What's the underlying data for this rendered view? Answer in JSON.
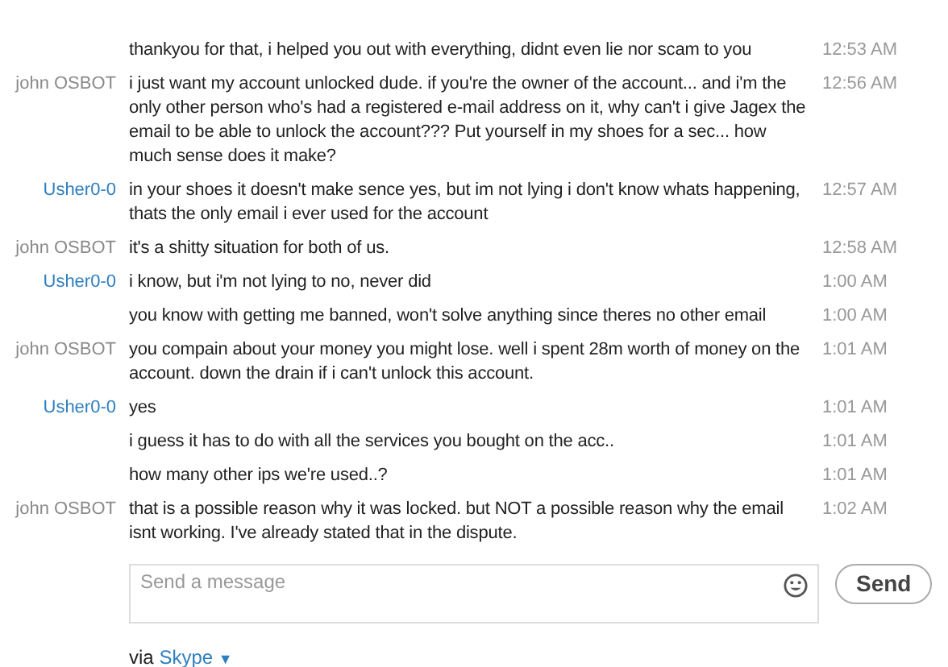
{
  "messages": [
    {
      "kind": "outgoing",
      "text": "thankyou for that, i helped you out with everything, didnt even lie nor scam to you",
      "time": "12:53 AM"
    },
    {
      "kind": "incoming",
      "sender": "john OSBOT",
      "text": "i just want my account unlocked dude. if you're the owner of the account... and i'm the only other person who's had a registered e-mail address on it, why can't i give Jagex the email to be able to unlock the account??? Put yourself in my shoes for a sec... how much sense does it make?",
      "time": "12:56 AM"
    },
    {
      "kind": "outgoing",
      "sender": "Usher0-0",
      "text": "in your shoes it doesn't make sence yes, but im not lying i don't know whats happening, thats the only email i ever used for the account",
      "time": "12:57 AM"
    },
    {
      "kind": "incoming",
      "sender": "john OSBOT",
      "text": "it's a shitty situation for both of us.",
      "time": "12:58 AM"
    },
    {
      "kind": "outgoing",
      "sender": "Usher0-0",
      "text": "i know, but i'm not lying to no, never did",
      "time": "1:00 AM"
    },
    {
      "kind": "outgoing",
      "text": "you know with getting me banned, won't solve anything since theres no other email",
      "time": "1:00 AM"
    },
    {
      "kind": "incoming",
      "sender": "john OSBOT",
      "text": "you compain about your money you might lose. well i spent 28m worth of money on the account. down the drain if i can't unlock this account.",
      "time": "1:01 AM"
    },
    {
      "kind": "outgoing",
      "sender": "Usher0-0",
      "text": "yes",
      "time": "1:01 AM"
    },
    {
      "kind": "outgoing",
      "text": "i guess it has to do with all the services you bought on the acc..",
      "time": "1:01 AM"
    },
    {
      "kind": "outgoing",
      "text": "how many other ips we're used..?",
      "time": "1:01 AM"
    },
    {
      "kind": "incoming",
      "sender": "john OSBOT",
      "text": "that is a possible reason why it was locked. but NOT a possible reason why the email isnt working. I've already stated that in the dispute.",
      "time": "1:02 AM"
    }
  ],
  "composer": {
    "placeholder": "Send a message",
    "send": "Send"
  },
  "via": {
    "prefix": "via",
    "service": "Skype",
    "caret": "▼"
  }
}
